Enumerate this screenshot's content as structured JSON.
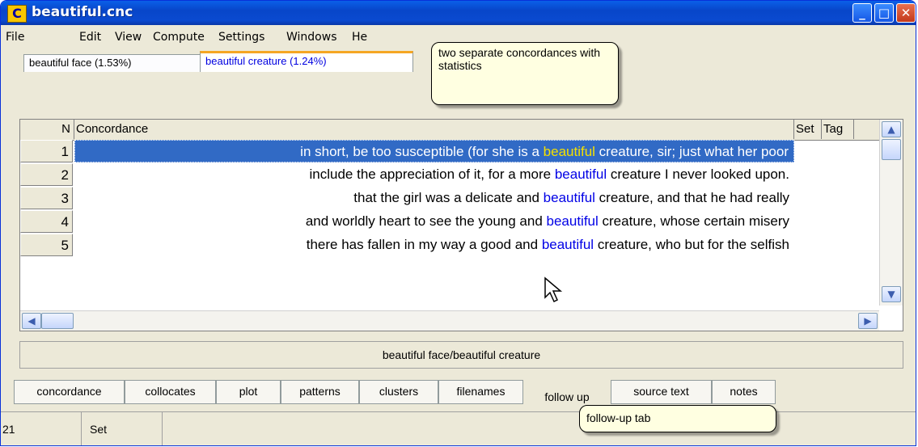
{
  "window": {
    "title": "beautiful.cnc",
    "app_icon": "C"
  },
  "menu": [
    "File",
    "Edit",
    "View",
    "Compute",
    "Settings",
    "Windows",
    "He"
  ],
  "doc_tabs": [
    {
      "label": "beautiful face (1.53%)"
    },
    {
      "label": "beautiful creature (1.24%)",
      "active": true
    }
  ],
  "grid": {
    "headers": {
      "n": "N",
      "concordance": "Concordance",
      "set": "Set",
      "tag": "Tag"
    },
    "rows": [
      {
        "n": "1",
        "left": "in short, be too susceptible (for she is a ",
        "keyword": "beautiful",
        "right": " creature, sir; just what her poor",
        "selected": true
      },
      {
        "n": "2",
        "left": "include the appreciation of it, for a more ",
        "keyword": "beautiful",
        "right": " creature I never looked upon."
      },
      {
        "n": "3",
        "left": "that the girl was a delicate and ",
        "keyword": "beautiful",
        "right": " creature, and that he had really"
      },
      {
        "n": "4",
        "left": "and worldly heart to see the young and ",
        "keyword": "beautiful",
        "right": " creature, whose certain misery"
      },
      {
        "n": "5",
        "left": "there has fallen in my way a good and ",
        "keyword": "beautiful",
        "right": " creature, who but for the selfish"
      }
    ]
  },
  "status_line": "beautiful face/beautiful creature",
  "bottom_tabs": [
    "concordance",
    "collocates",
    "plot",
    "patterns",
    "clusters",
    "filenames",
    "follow up",
    "source text",
    "notes"
  ],
  "active_bottom_tab": "follow up",
  "status_bar": {
    "count": "21",
    "label": "Set"
  },
  "callouts": {
    "top": "two separate concordances with statistics",
    "bottom": "follow-up tab"
  },
  "colors": {
    "selection": "#316ac5",
    "keyword": "#0000e6",
    "selected_keyword": "#f5e000",
    "titlebar": "#0a4ad0"
  },
  "icons": [
    "minimize-icon",
    "maximize-icon",
    "close-icon",
    "scroll-up-icon",
    "scroll-down-icon",
    "scroll-left-icon",
    "scroll-right-icon",
    "mouse-pointer-icon"
  ]
}
